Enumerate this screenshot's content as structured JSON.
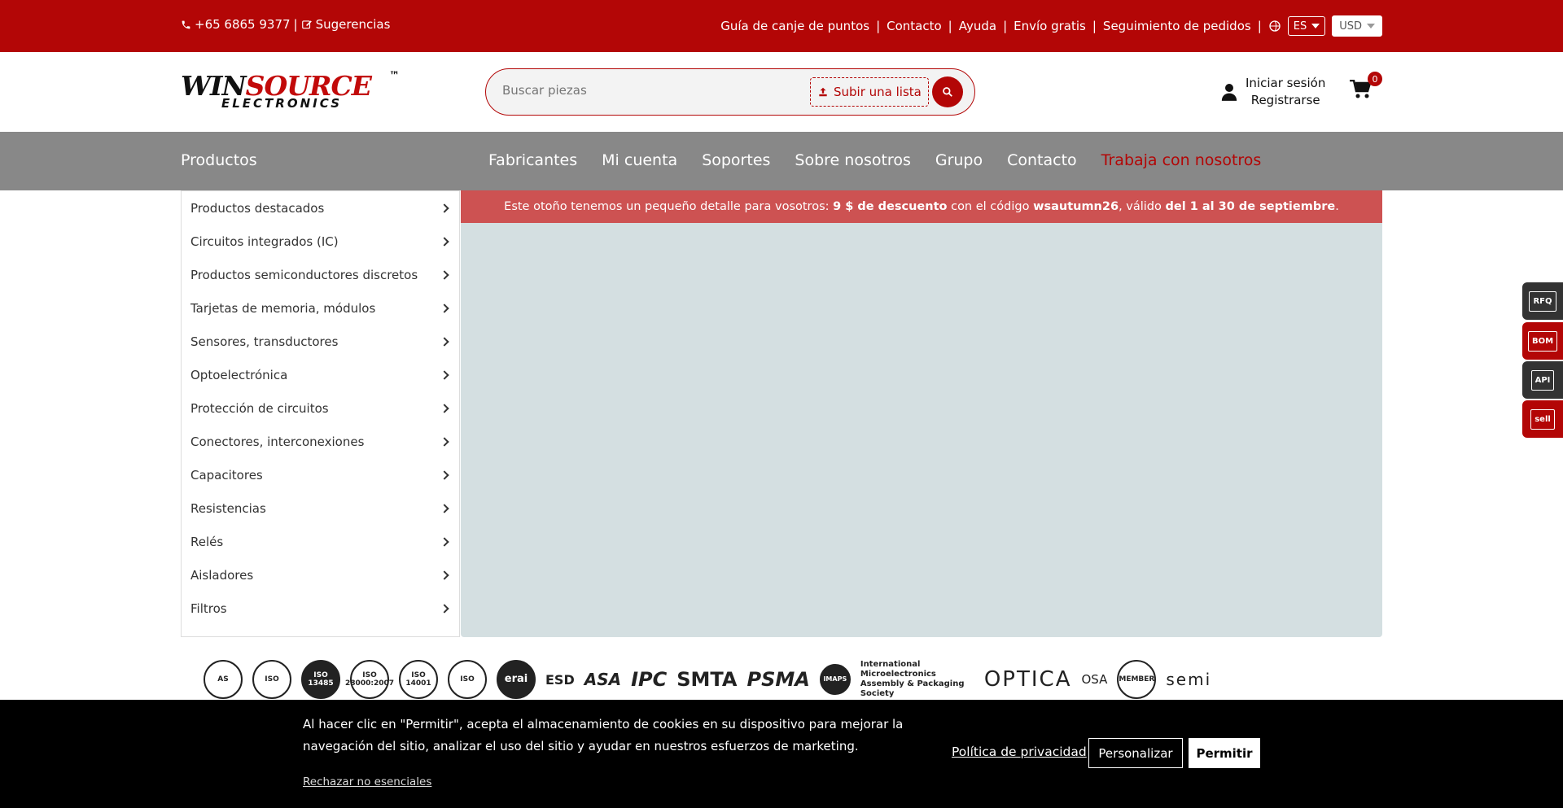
{
  "topbar": {
    "phone": "+65 6865 9377",
    "separator": "|",
    "suggestions": "Sugerencias",
    "links": [
      "Guía de canje de puntos",
      "Contacto",
      "Ayuda",
      "Envío gratis",
      "Seguimiento de pedidos"
    ],
    "language": "ES",
    "currency": "USD"
  },
  "header": {
    "logo_top_1": "WIN",
    "logo_top_2": "SOURCE",
    "logo_bottom": "ELECTRONICS",
    "logo_tm": "™",
    "search_placeholder": "Buscar piezas",
    "upload_label": "Subir una lista",
    "login": "Iniciar sesión",
    "register": "Registrarse",
    "cart_count": "0"
  },
  "nav": {
    "products": "Productos",
    "links": [
      "Fabricantes",
      "Mi cuenta",
      "Soportes",
      "Sobre nosotros",
      "Grupo",
      "Contacto"
    ],
    "highlight": "Trabaja con nosotros"
  },
  "sidebar": {
    "items": [
      "Productos destacados",
      "Circuitos integrados (IC)",
      "Productos semiconductores discretos",
      "Tarjetas de memoria, módulos",
      "Sensores, transductores",
      "Optoelectrónica",
      "Protección de circuitos",
      "Conectores, interconexiones",
      "Capacitores",
      "Resistencias",
      "Relés",
      "Aisladores",
      "Filtros"
    ]
  },
  "promo": {
    "p1": "Este otoño tenemos un pequeño detalle para vosotros: ",
    "b1": "9 $ de descuento",
    "p2": " con el código ",
    "b2": "wsautumn26",
    "p3": ", válido ",
    "b3": "del 1 al 30 de septiembre",
    "p4": "."
  },
  "certs": {
    "seals": [
      "AS",
      "ISO",
      "ISO 13485",
      "ISO 28000:2007",
      "ISO 14001",
      "ISO"
    ],
    "erai": "erai",
    "esd": "ESD",
    "asa": "ASA",
    "ipc": "IPC",
    "smta": "SMTA",
    "psma": "PSMA",
    "imaps": "IMAPS",
    "imaps_text": "International Microelectronics Assembly & Packaging Society",
    "optica": "OPTICA",
    "osa": "OSA",
    "nmi": "MEMBER",
    "semi": "semi"
  },
  "side_buttons": [
    "RFQ",
    "BOM",
    "API",
    "sell"
  ],
  "cookie": {
    "message": "Al hacer clic en \"Permitir\", acepta el almacenamiento de cookies en su dispositivo para mejorar la navegación del sitio, analizar el uso del sitio y ayudar en nuestros esfuerzos de marketing.",
    "reject": "Rechazar no esenciales",
    "policy": "Política de privacidad",
    "customize": "Personalizar",
    "allow": "Permitir"
  },
  "colors": {
    "brand_red": "#b30606",
    "nav_gray": "#888888",
    "hero_bg": "#d4dfe1"
  }
}
